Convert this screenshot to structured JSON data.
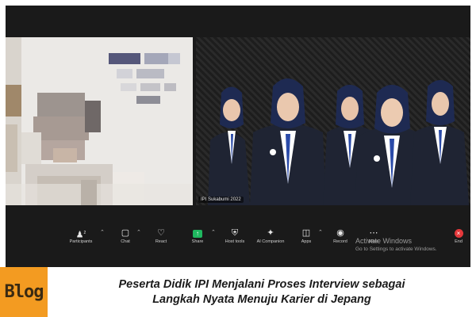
{
  "meeting": {
    "right_tile_label": "IPI Sukabumi 2022"
  },
  "toolbar": {
    "items": [
      {
        "label": "Participants",
        "icon": "participants-icon",
        "badge": "2"
      },
      {
        "label": "Chat",
        "icon": "chat-icon"
      },
      {
        "label": "React",
        "icon": "heart-icon"
      },
      {
        "label": "Share",
        "icon": "share-icon"
      },
      {
        "label": "Host tools",
        "icon": "shield-icon"
      },
      {
        "label": "AI Companion",
        "icon": "sparkle-icon"
      },
      {
        "label": "Apps",
        "icon": "apps-icon"
      },
      {
        "label": "Record",
        "icon": "record-icon"
      },
      {
        "label": "More",
        "icon": "more-icon"
      },
      {
        "label": "End",
        "icon": "close-icon"
      }
    ],
    "share_color": "#1fb85f",
    "end_color": "#e5383b"
  },
  "watermark": {
    "title": "Activate Windows",
    "subtitle": "Go to Settings to activate Windows."
  },
  "banner": {
    "badge": "Blog",
    "badge_color": "#f39b21",
    "headline_line1": "Peserta Didik IPI Menjalani Proses Interview sebagai",
    "headline_line2": "Langkah Nyata Menuju Karier di Jepang"
  }
}
